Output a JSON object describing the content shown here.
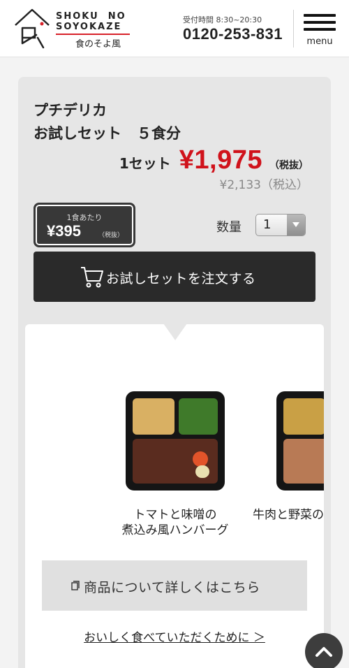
{
  "header": {
    "logo_en": "SHOKU  NO\nSOYOKAZE",
    "logo_jp": "食のそよ風",
    "tel_label": "受付時間 8:30~20:30",
    "tel_number": "0120-253-831",
    "menu_label": "menu"
  },
  "product": {
    "title_line1": "プチデリカ",
    "title_line2": "お試しセット",
    "title_qty": "５食分",
    "set_label": "1セット",
    "price": "¥1,975",
    "tax_excluded": "（税抜）",
    "price_incl": "¥2,133（税込）",
    "unit_label": "1食あたり",
    "unit_price": "¥395",
    "unit_tax": "（税抜）",
    "qty_label": "数量",
    "qty_value": "1",
    "order_button": "お試しセットを注文する"
  },
  "meals": [
    {
      "name": "トマトと味噌の\n煮込み風ハンバーグ",
      "icon": "meal-photo"
    },
    {
      "name": "牛肉と野菜の",
      "icon": "meal-photo"
    }
  ],
  "links": {
    "detail_button": "商品について詳しくはこちら",
    "howto_link": "おいしく食べていただくために ＞"
  },
  "colors": {
    "price_red": "#d0121b",
    "dark_button": "#2a2a2a",
    "logo_accent": "#d8222a"
  }
}
